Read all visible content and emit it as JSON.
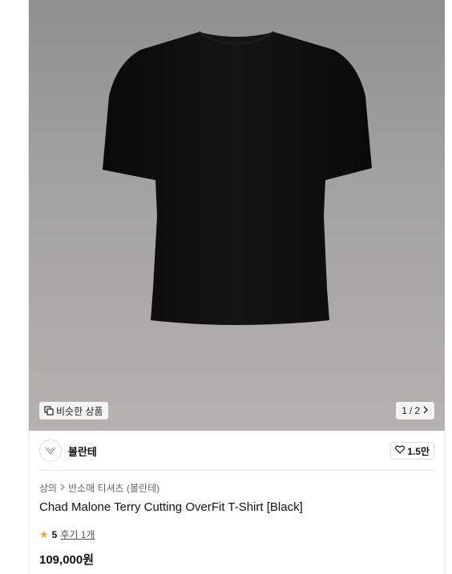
{
  "product": {
    "similar_label": "비슷한 상품",
    "pager": {
      "current": "1",
      "separator": "/",
      "total": "2"
    },
    "brand": {
      "name": "볼란테",
      "logo_text": "V"
    },
    "likes": "1.5만",
    "breadcrumb": [
      "상의",
      "반소매 티셔츠 (볼란테)"
    ],
    "title": "Chad Malone Terry Cutting OverFit T-Shirt [Black]",
    "rating": {
      "score": "5",
      "review_label": "후기 1개"
    },
    "price": "109,000원"
  },
  "colors": {
    "accent_star": "#f5a623",
    "shirt": "#0f0f0f"
  },
  "icons": [
    "copy-icon",
    "chevron-right-icon",
    "heart-icon",
    "star-icon"
  ]
}
